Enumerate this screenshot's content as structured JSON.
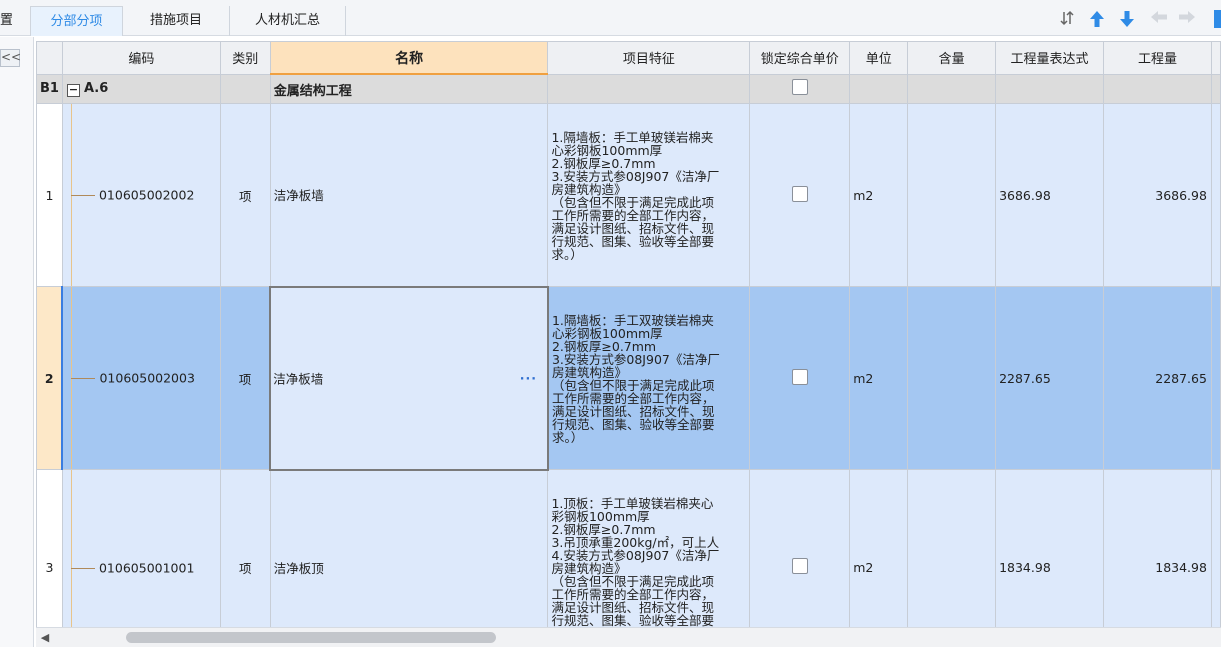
{
  "toolbar": {
    "cut_label": "置",
    "tabs": [
      {
        "label": "分部分项",
        "active": true
      },
      {
        "label": "措施项目",
        "active": false
      },
      {
        "label": "人材机汇总",
        "active": false
      }
    ],
    "icons": [
      "sort-icon",
      "arrow-up-icon",
      "arrow-down-icon",
      "arrow-left-icon",
      "arrow-right-icon"
    ]
  },
  "left_strip": {
    "collapse_label": "<<"
  },
  "grid": {
    "columns": [
      "",
      "编码",
      "类别",
      "名称",
      "项目特征",
      "锁定综合单价",
      "单位",
      "含量",
      "工程量表达式",
      "工程量"
    ],
    "group": {
      "id": "B1",
      "code": "A.6",
      "name": "金属结构工程"
    },
    "rows": [
      {
        "num": "1",
        "code": "010605002002",
        "type": "项",
        "name": "洁净板墙",
        "desc": "1.隔墙板：手工单玻镁岩棉夹\n心彩钢板100mm厚\n2.钢板厚≥0.7mm\n3.安装方式参08J907《洁净厂\n房建筑构造》\n（包含但不限于满足完成此项\n工作所需要的全部工作内容，\n满足设计图纸、招标文件、现\n行规范、图集、验收等全部要\n求。）",
        "unit": "m2",
        "content": "",
        "expr": "3686.98",
        "qty": "3686.98",
        "selected": false
      },
      {
        "num": "2",
        "code": "010605002003",
        "type": "项",
        "name": "洁净板墙",
        "desc": "1.隔墙板：手工双玻镁岩棉夹\n心彩钢板100mm厚\n2.钢板厚≥0.7mm\n3.安装方式参08J907《洁净厂\n房建筑构造》\n（包含但不限于满足完成此项\n工作所需要的全部工作内容，\n满足设计图纸、招标文件、现\n行规范、图集、验收等全部要\n求。）",
        "unit": "m2",
        "content": "",
        "expr": "2287.65",
        "qty": "2287.65",
        "selected": true,
        "name_button": "···"
      },
      {
        "num": "3",
        "code": "010605001001",
        "type": "项",
        "name": "洁净板顶",
        "desc": "1.顶板：手工单玻镁岩棉夹心\n彩钢板100mm厚\n2.钢板厚≥0.7mm\n3.吊顶承重200kg/㎡，可上人\n4.安装方式参08J907《洁净厂\n房建筑构造》\n（包含但不限于满足完成此项\n工作所需要的全部工作内容，\n满足设计图纸、招标文件、现\n行规范、图集、验收等全部要\n求。）",
        "unit": "m2",
        "content": "",
        "expr": "1834.98",
        "qty": "1834.98",
        "selected": false
      }
    ]
  },
  "scrollbar": {
    "left_arrow": "◀"
  },
  "colors": {
    "accent": "#2f8be6",
    "row_bg": "#dde9fb",
    "selected_bg": "#a4c7f2",
    "name_header": "#fde2bd"
  }
}
